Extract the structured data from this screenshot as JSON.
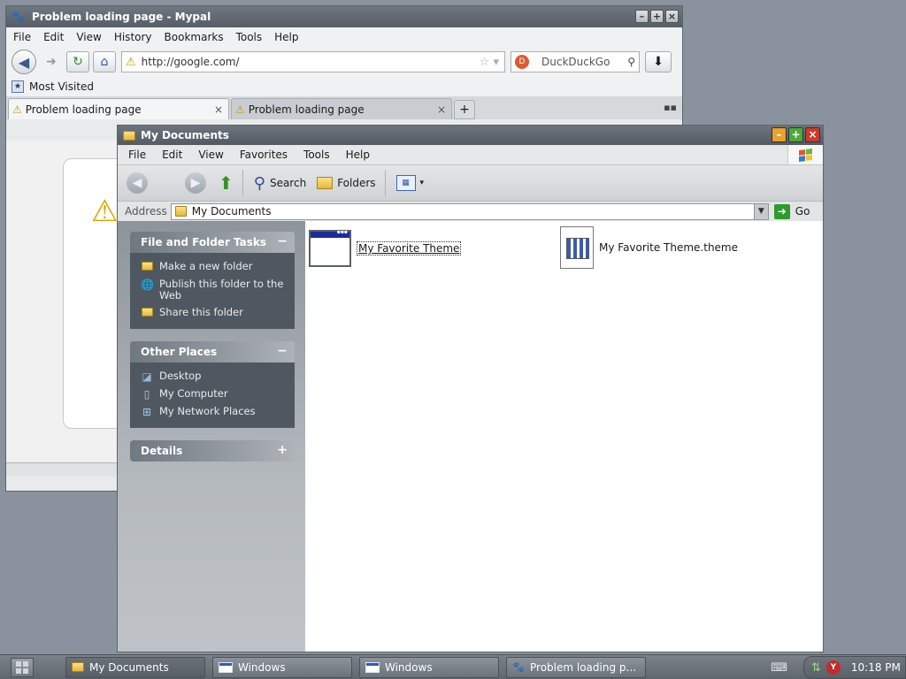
{
  "browser": {
    "title": "Problem loading page - Mypal",
    "menu": [
      "File",
      "Edit",
      "View",
      "History",
      "Bookmarks",
      "Tools",
      "Help"
    ],
    "url": "http://google.com/",
    "search_engine": "DuckDuckGo",
    "bookmark": "Most Visited",
    "tabs": [
      {
        "label": "Problem loading page",
        "active": true
      },
      {
        "label": "Problem loading page",
        "active": false
      }
    ]
  },
  "explorer": {
    "title": "My Documents",
    "menu": [
      "File",
      "Edit",
      "View",
      "Favorites",
      "Tools",
      "Help"
    ],
    "toolbar": {
      "search": "Search",
      "folders": "Folders"
    },
    "address": {
      "label": "Address",
      "value": "My Documents",
      "go": "Go"
    },
    "panels": {
      "tasks": {
        "title": "File and Folder Tasks",
        "toggle": "−",
        "items": [
          "Make a new folder",
          "Publish this folder to the Web",
          "Share this folder"
        ]
      },
      "places": {
        "title": "Other Places",
        "toggle": "−",
        "items": [
          "Desktop",
          "My Computer",
          "My Network Places"
        ]
      },
      "details": {
        "title": "Details",
        "toggle": "+"
      }
    },
    "files": [
      {
        "name": "My Favorite Theme",
        "icon": "theme-window-icon",
        "selected": true
      },
      {
        "name": "My Favorite Theme.theme",
        "icon": "theme-file-icon",
        "selected": false
      }
    ]
  },
  "taskbar": {
    "items": [
      "My Documents",
      "Windows",
      "Windows",
      "Problem loading p..."
    ],
    "clock": "10:18 PM"
  },
  "colors": {
    "desktop": "#8a929d",
    "sidebar_panel": "#4f5860",
    "title_bar": "#565d66",
    "close_button": "#cc3b2b",
    "maximize_button": "#4caa3a",
    "minimize_button": "#e8a22d"
  }
}
